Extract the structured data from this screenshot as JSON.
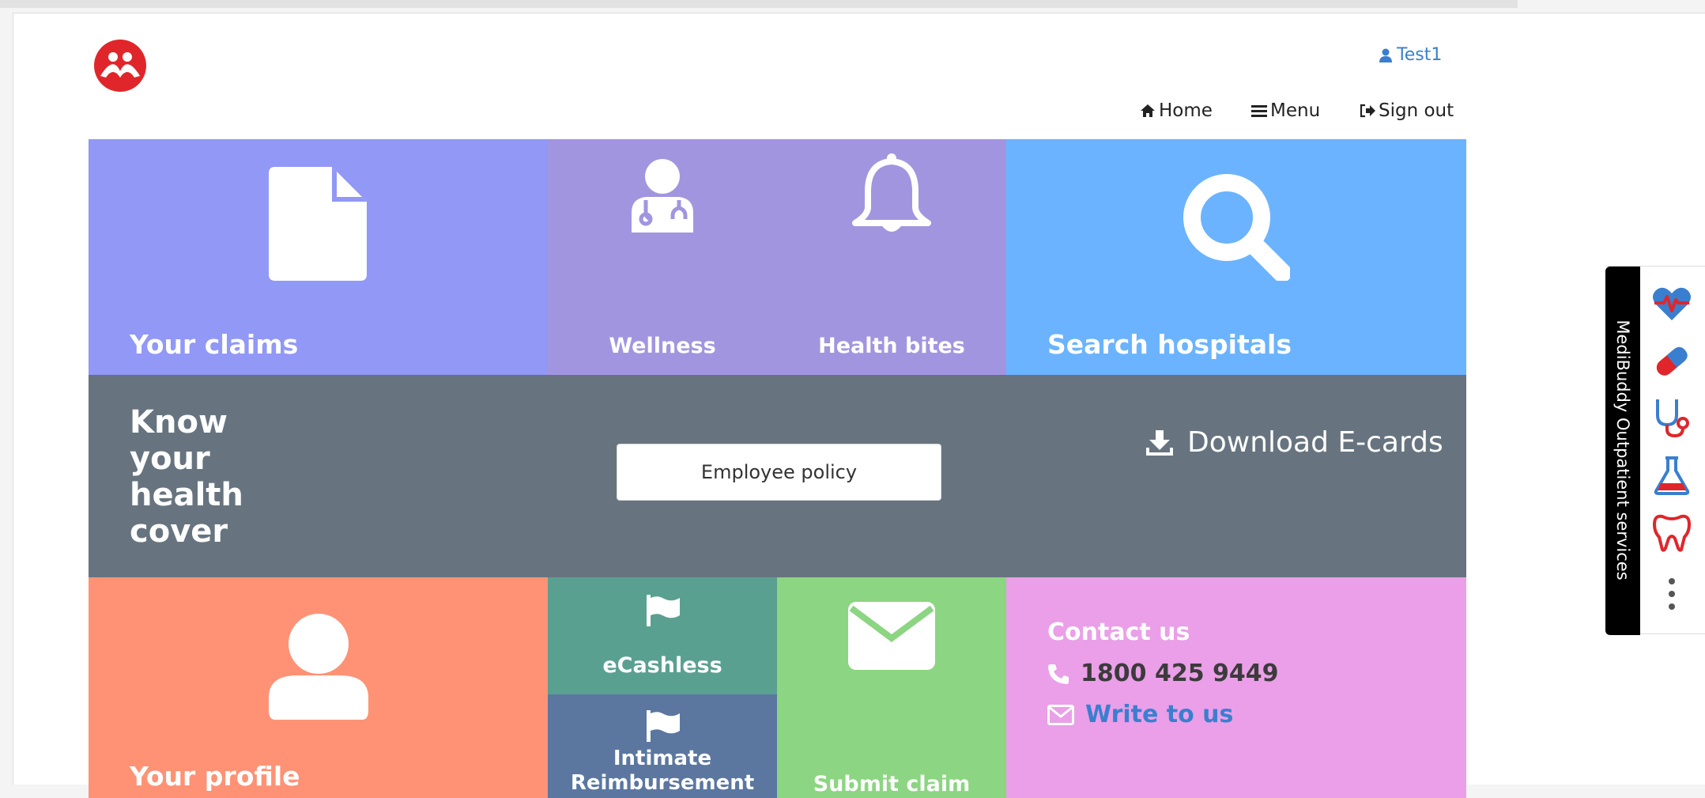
{
  "header": {
    "user_name": "Test1",
    "nav": {
      "home": "Home",
      "menu": "Menu",
      "sign_out": "Sign out"
    }
  },
  "tiles": {
    "claims": "Your claims",
    "wellness": "Wellness",
    "health_bites": "Health bites",
    "search_hospitals": "Search hospitals",
    "cover_title": "Know your health cover",
    "employee_policy": "Employee policy",
    "download_ecards": "Download E-cards",
    "profile": "Your profile",
    "ecashless": "eCashless",
    "intimate": "Intimate Reimbursement",
    "submit_claim": "Submit claim"
  },
  "contact": {
    "title": "Contact us",
    "phone": "1800 425 9449",
    "write": "Write to us"
  },
  "side_panel": {
    "label": "MediBuddy Outpatient services",
    "icons": [
      "heart-pulse-icon",
      "pill-icon",
      "stethoscope-icon",
      "lab-flask-icon",
      "tooth-icon",
      "more-vertical-icon"
    ]
  },
  "colors": {
    "claims": "#9198f5",
    "wellness": "#a295df",
    "search": "#6bb3ff",
    "cover": "#67747f",
    "profile": "#ff9275",
    "ecashless": "#5aa091",
    "intimate": "#5b77a0",
    "submit": "#8cd582",
    "contact": "#ea9fe8",
    "brand_red": "#e0262b",
    "link_blue": "#3a7fcf"
  }
}
